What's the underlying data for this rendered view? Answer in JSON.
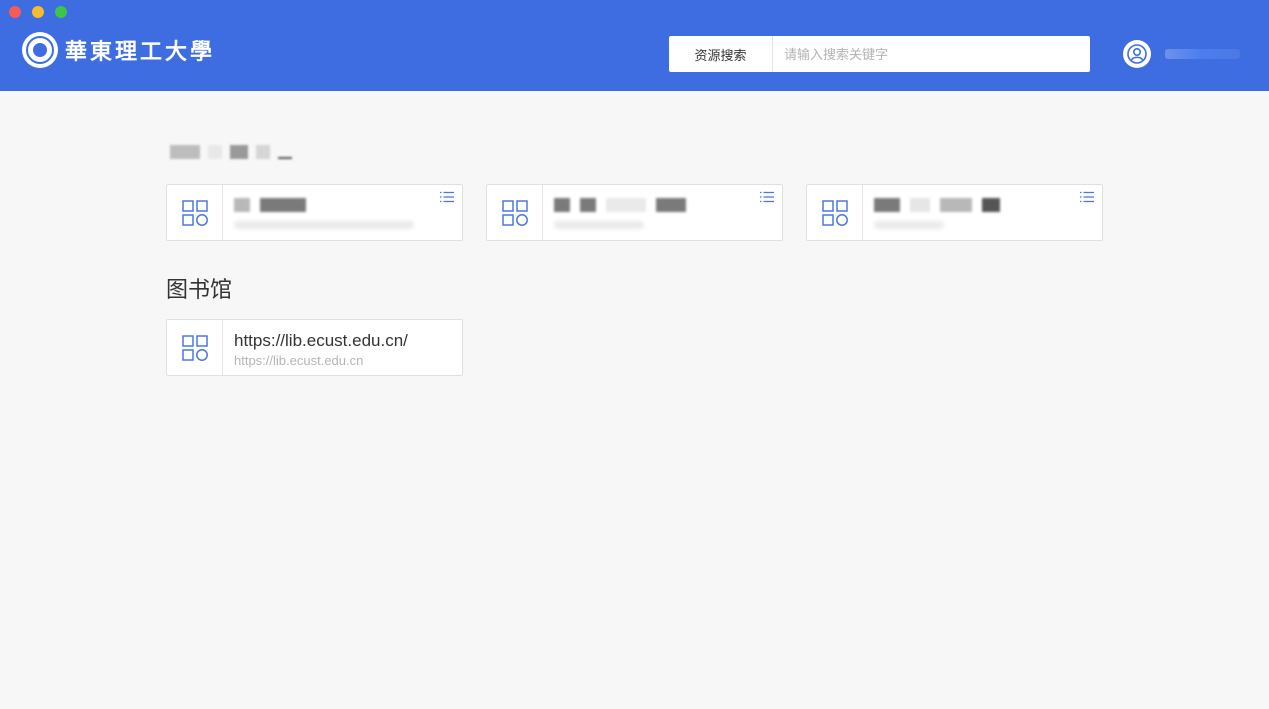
{
  "header": {
    "logo_text": "華東理工大學",
    "search": {
      "button_label": "资源搜索",
      "placeholder": "请输入搜索关键字",
      "value": ""
    },
    "user": {
      "avatar_icon": "user-icon",
      "name": ""
    }
  },
  "colors": {
    "header_bg": "#3d6de0",
    "accent": "#3d6de0",
    "page_bg": "#f7f7f7"
  },
  "favorites": {
    "title": "",
    "cards": [
      {
        "title": "",
        "url": "",
        "icon": "apps-icon",
        "menu_icon": "list-icon"
      },
      {
        "title": "",
        "url": "",
        "icon": "apps-icon",
        "menu_icon": "list-icon"
      },
      {
        "title": "",
        "url": "",
        "icon": "apps-icon",
        "menu_icon": "list-icon"
      }
    ]
  },
  "library": {
    "title": "图书馆",
    "cards": [
      {
        "title": "https://lib.ecust.edu.cn/",
        "url": "https://lib.ecust.edu.cn",
        "icon": "apps-icon"
      }
    ]
  }
}
